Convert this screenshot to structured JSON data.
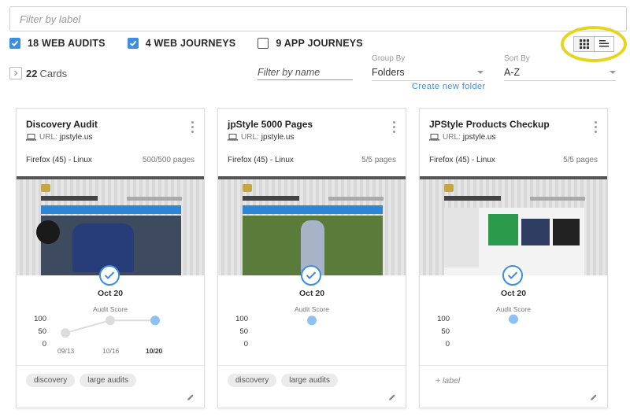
{
  "filter": {
    "placeholder": "Filter by label"
  },
  "types": [
    {
      "label": "18 WEB AUDITS",
      "checked": true
    },
    {
      "label": "4 WEB JOURNEYS",
      "checked": true
    },
    {
      "label": "9 APP JOURNEYS",
      "checked": false
    }
  ],
  "view": {
    "active": "grid",
    "icons": [
      "grid-icon",
      "list-icon"
    ]
  },
  "cards_summary": {
    "count": "22",
    "label": "Cards"
  },
  "filter_name": {
    "placeholder": "Filter by name"
  },
  "group_by": {
    "label": "Group By",
    "value": "Folders",
    "link": "Create new folder"
  },
  "sort_by": {
    "label": "Sort By",
    "value": "A-Z"
  },
  "colors": {
    "accent": "#3d8ede",
    "highlight": "#e5d51c",
    "point_active": "#8fc0f2",
    "point_past": "#dcdcdc"
  },
  "cards": [
    {
      "title": "Discovery Audit",
      "url_label": "URL:",
      "url": "jpstyle.us",
      "browser": "Firefox (45) - Linux",
      "pages": "500/500 pages",
      "date": "Oct 20",
      "score_label": "Audit Score",
      "axis": [
        "100",
        "50",
        "0"
      ],
      "x_labels": [
        "09/13",
        "10/16",
        "10/20"
      ],
      "scores": [
        40,
        90,
        90
      ],
      "tags": [
        "discovery",
        "large audits"
      ],
      "add_label": ""
    },
    {
      "title": "jpStyle 5000 Pages",
      "url_label": "URL:",
      "url": "jpstyle.us",
      "browser": "Firefox (45) - Linux",
      "pages": "5/5 pages",
      "date": "Oct 20",
      "score_label": "Audit Score",
      "axis": [
        "100",
        "50",
        "0"
      ],
      "x_labels": [],
      "scores": [
        90
      ],
      "tags": [
        "discovery",
        "large audits"
      ],
      "add_label": ""
    },
    {
      "title": "JPStyle Products Checkup",
      "url_label": "URL:",
      "url": "jpstyle.us",
      "browser": "Firefox (45) - Linux",
      "pages": "5/5 pages",
      "date": "Oct 20",
      "score_label": "Audit Score",
      "axis": [
        "100",
        "50",
        "0"
      ],
      "x_labels": [],
      "scores": [
        95
      ],
      "tags": [],
      "add_label": "+ label"
    }
  ]
}
